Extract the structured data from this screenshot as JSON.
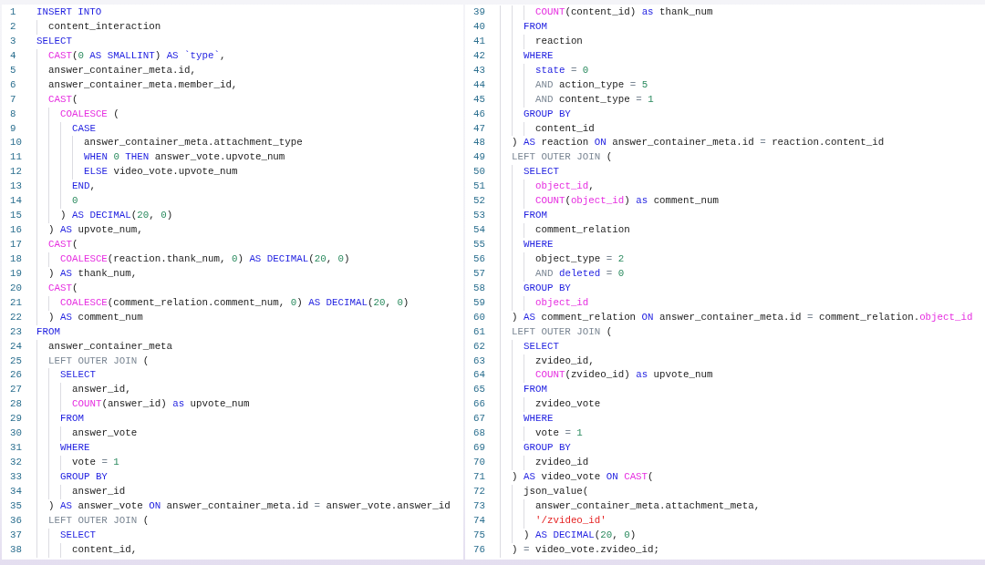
{
  "listing": [
    {
      "number": "1",
      "tokens": [
        {
          "kind": "keyword",
          "text": "INSERT INTO"
        }
      ],
      "children": [
        {
          "number": "2",
          "tokens": [
            {
              "kind": "plain",
              "text": "content_interaction"
            }
          ]
        }
      ]
    },
    {
      "number": "3",
      "tokens": [
        {
          "kind": "keyword",
          "text": "SELECT"
        }
      ],
      "children": [
        {
          "number": "4",
          "tokens": [
            {
              "kind": "function",
              "text": "CAST"
            },
            {
              "kind": "plain",
              "text": "("
            },
            {
              "kind": "number",
              "text": "0"
            },
            {
              "kind": "keyword",
              "text": " AS SMALLINT"
            },
            {
              "kind": "plain",
              "text": ") "
            },
            {
              "kind": "keyword",
              "text": "AS `type`"
            },
            {
              "kind": "plain",
              "text": ","
            }
          ]
        },
        {
          "number": "5",
          "tokens": [
            {
              "kind": "plain",
              "text": "answer_container_meta.id,"
            }
          ]
        },
        {
          "number": "6",
          "tokens": [
            {
              "kind": "plain",
              "text": "answer_container_meta.member_id,"
            }
          ]
        },
        {
          "number": "7",
          "tokens": [
            {
              "kind": "function",
              "text": "CAST"
            },
            {
              "kind": "plain",
              "text": "("
            }
          ],
          "children": [
            {
              "number": "8",
              "tokens": [
                {
                  "kind": "function",
                  "text": "COALESCE"
                },
                {
                  "kind": "plain",
                  "text": " ("
                }
              ],
              "children": [
                {
                  "number": "9",
                  "tokens": [
                    {
                      "kind": "keyword",
                      "text": "CASE"
                    }
                  ],
                  "children": [
                    {
                      "number": "10",
                      "tokens": [
                        {
                          "kind": "plain",
                          "text": "answer_container_meta.attachment_type"
                        }
                      ]
                    },
                    {
                      "number": "11",
                      "tokens": [
                        {
                          "kind": "keyword",
                          "text": "WHEN"
                        },
                        {
                          "kind": "number",
                          "text": " 0"
                        },
                        {
                          "kind": "keyword",
                          "text": " THEN"
                        },
                        {
                          "kind": "plain",
                          "text": " answer_vote.upvote_num"
                        }
                      ]
                    },
                    {
                      "number": "12",
                      "tokens": [
                        {
                          "kind": "keyword",
                          "text": "ELSE"
                        },
                        {
                          "kind": "plain",
                          "text": " video_vote.upvote_num"
                        }
                      ]
                    }
                  ]
                },
                {
                  "number": "13",
                  "tokens": [
                    {
                      "kind": "keyword",
                      "text": "END"
                    },
                    {
                      "kind": "plain",
                      "text": ","
                    }
                  ]
                },
                {
                  "number": "14",
                  "tokens": [
                    {
                      "kind": "number",
                      "text": "0"
                    }
                  ]
                }
              ]
            },
            {
              "number": "15",
              "tokens": [
                {
                  "kind": "plain",
                  "text": ") "
                },
                {
                  "kind": "keyword",
                  "text": "AS DECIMAL"
                },
                {
                  "kind": "plain",
                  "text": "("
                },
                {
                  "kind": "number",
                  "text": "20"
                },
                {
                  "kind": "plain",
                  "text": ", "
                },
                {
                  "kind": "number",
                  "text": "0"
                },
                {
                  "kind": "plain",
                  "text": ")"
                }
              ]
            }
          ]
        },
        {
          "number": "16",
          "tokens": [
            {
              "kind": "plain",
              "text": ") "
            },
            {
              "kind": "keyword",
              "text": "AS"
            },
            {
              "kind": "plain",
              "text": " upvote_num,"
            }
          ]
        },
        {
          "number": "17",
          "tokens": [
            {
              "kind": "function",
              "text": "CAST"
            },
            {
              "kind": "plain",
              "text": "("
            }
          ],
          "children": [
            {
              "number": "18",
              "tokens": [
                {
                  "kind": "function",
                  "text": "COALESCE"
                },
                {
                  "kind": "plain",
                  "text": "(reaction.thank_num, "
                },
                {
                  "kind": "number",
                  "text": "0"
                },
                {
                  "kind": "plain",
                  "text": ") "
                },
                {
                  "kind": "keyword",
                  "text": "AS DECIMAL"
                },
                {
                  "kind": "plain",
                  "text": "("
                },
                {
                  "kind": "number",
                  "text": "20"
                },
                {
                  "kind": "plain",
                  "text": ", "
                },
                {
                  "kind": "number",
                  "text": "0"
                },
                {
                  "kind": "plain",
                  "text": ")"
                }
              ]
            }
          ]
        },
        {
          "number": "19",
          "tokens": [
            {
              "kind": "plain",
              "text": ") "
            },
            {
              "kind": "keyword",
              "text": "AS"
            },
            {
              "kind": "plain",
              "text": " thank_num,"
            }
          ]
        },
        {
          "number": "20",
          "tokens": [
            {
              "kind": "function",
              "text": "CAST"
            },
            {
              "kind": "plain",
              "text": "("
            }
          ],
          "children": [
            {
              "number": "21",
              "tokens": [
                {
                  "kind": "function",
                  "text": "COALESCE"
                },
                {
                  "kind": "plain",
                  "text": "(comment_relation.comment_num, "
                },
                {
                  "kind": "number",
                  "text": "0"
                },
                {
                  "kind": "plain",
                  "text": ") "
                },
                {
                  "kind": "keyword",
                  "text": "AS DECIMAL"
                },
                {
                  "kind": "plain",
                  "text": "("
                },
                {
                  "kind": "number",
                  "text": "20"
                },
                {
                  "kind": "plain",
                  "text": ", "
                },
                {
                  "kind": "number",
                  "text": "0"
                },
                {
                  "kind": "plain",
                  "text": ")"
                }
              ]
            }
          ]
        },
        {
          "number": "22",
          "tokens": [
            {
              "kind": "plain",
              "text": ") "
            },
            {
              "kind": "keyword",
              "text": "AS"
            },
            {
              "kind": "plain",
              "text": " comment_num"
            }
          ]
        }
      ]
    },
    {
      "number": "23",
      "tokens": [
        {
          "kind": "keyword",
          "text": "FROM"
        }
      ],
      "children": [
        {
          "number": "24",
          "tokens": [
            {
              "kind": "plain",
              "text": "answer_container_meta"
            }
          ]
        },
        {
          "number": "25",
          "tokens": [
            {
              "kind": "muted",
              "text": "LEFT OUTER JOIN"
            },
            {
              "kind": "plain",
              "text": " ("
            }
          ],
          "children": [
            {
              "number": "26",
              "tokens": [
                {
                  "kind": "keyword",
                  "text": "SELECT"
                }
              ],
              "children": [
                {
                  "number": "27",
                  "tokens": [
                    {
                      "kind": "plain",
                      "text": "answer_id,"
                    }
                  ]
                },
                {
                  "number": "28",
                  "tokens": [
                    {
                      "kind": "function",
                      "text": "COUNT"
                    },
                    {
                      "kind": "plain",
                      "text": "(answer_id) "
                    },
                    {
                      "kind": "keyword",
                      "text": "as"
                    },
                    {
                      "kind": "plain",
                      "text": " upvote_num"
                    }
                  ]
                }
              ]
            },
            {
              "number": "29",
              "tokens": [
                {
                  "kind": "keyword",
                  "text": "FROM"
                }
              ],
              "children": [
                {
                  "number": "30",
                  "tokens": [
                    {
                      "kind": "plain",
                      "text": "answer_vote"
                    }
                  ]
                }
              ]
            },
            {
              "number": "31",
              "tokens": [
                {
                  "kind": "keyword",
                  "text": "WHERE"
                }
              ],
              "children": [
                {
                  "number": "32",
                  "tokens": [
                    {
                      "kind": "plain",
                      "text": "vote "
                    },
                    {
                      "kind": "muted",
                      "text": "="
                    },
                    {
                      "kind": "number",
                      "text": " 1"
                    }
                  ]
                }
              ]
            },
            {
              "number": "33",
              "tokens": [
                {
                  "kind": "keyword",
                  "text": "GROUP BY"
                }
              ],
              "children": [
                {
                  "number": "34",
                  "tokens": [
                    {
                      "kind": "plain",
                      "text": "answer_id"
                    }
                  ]
                }
              ]
            }
          ]
        },
        {
          "number": "35",
          "tokens": [
            {
              "kind": "plain",
              "text": ") "
            },
            {
              "kind": "keyword",
              "text": "AS"
            },
            {
              "kind": "plain",
              "text": " answer_vote "
            },
            {
              "kind": "keyword",
              "text": "ON"
            },
            {
              "kind": "plain",
              "text": " answer_container_meta.id "
            },
            {
              "kind": "muted",
              "text": "="
            },
            {
              "kind": "plain",
              "text": " answer_vote.answer_id"
            }
          ]
        },
        {
          "number": "36",
          "tokens": [
            {
              "kind": "muted",
              "text": "LEFT OUTER JOIN"
            },
            {
              "kind": "plain",
              "text": " ("
            }
          ],
          "children": [
            {
              "number": "37",
              "tokens": [
                {
                  "kind": "keyword",
                  "text": "SELECT"
                }
              ],
              "children": [
                {
                  "number": "38",
                  "tokens": [
                    {
                      "kind": "plain",
                      "text": "content_id,"
                    }
                  ]
                },
                {
                  "number": "39",
                  "tokens": [
                    {
                      "kind": "function",
                      "text": "COUNT"
                    },
                    {
                      "kind": "plain",
                      "text": "(content_id) "
                    },
                    {
                      "kind": "keyword",
                      "text": "as"
                    },
                    {
                      "kind": "plain",
                      "text": " thank_num"
                    }
                  ]
                }
              ]
            },
            {
              "number": "40",
              "tokens": [
                {
                  "kind": "keyword",
                  "text": "FROM"
                }
              ],
              "children": [
                {
                  "number": "41",
                  "tokens": [
                    {
                      "kind": "plain",
                      "text": "reaction"
                    }
                  ]
                }
              ]
            },
            {
              "number": "42",
              "tokens": [
                {
                  "kind": "keyword",
                  "text": "WHERE"
                }
              ],
              "children": [
                {
                  "number": "43",
                  "tokens": [
                    {
                      "kind": "keyword",
                      "text": "state"
                    },
                    {
                      "kind": "muted",
                      "text": " ="
                    },
                    {
                      "kind": "number",
                      "text": " 0"
                    }
                  ]
                },
                {
                  "number": "44",
                  "tokens": [
                    {
                      "kind": "muted",
                      "text": "AND"
                    },
                    {
                      "kind": "plain",
                      "text": " action_type "
                    },
                    {
                      "kind": "muted",
                      "text": "="
                    },
                    {
                      "kind": "number",
                      "text": " 5"
                    }
                  ]
                },
                {
                  "number": "45",
                  "tokens": [
                    {
                      "kind": "muted",
                      "text": "AND"
                    },
                    {
                      "kind": "plain",
                      "text": " content_type "
                    },
                    {
                      "kind": "muted",
                      "text": "="
                    },
                    {
                      "kind": "number",
                      "text": " 1"
                    }
                  ]
                }
              ]
            },
            {
              "number": "46",
              "tokens": [
                {
                  "kind": "keyword",
                  "text": "GROUP BY"
                }
              ],
              "children": [
                {
                  "number": "47",
                  "tokens": [
                    {
                      "kind": "plain",
                      "text": "content_id"
                    }
                  ]
                }
              ]
            }
          ]
        },
        {
          "number": "48",
          "tokens": [
            {
              "kind": "plain",
              "text": ") "
            },
            {
              "kind": "keyword",
              "text": "AS"
            },
            {
              "kind": "plain",
              "text": " reaction "
            },
            {
              "kind": "keyword",
              "text": "ON"
            },
            {
              "kind": "plain",
              "text": " answer_container_meta.id "
            },
            {
              "kind": "muted",
              "text": "="
            },
            {
              "kind": "plain",
              "text": " reaction.content_id"
            }
          ]
        },
        {
          "number": "49",
          "tokens": [
            {
              "kind": "muted",
              "text": "LEFT OUTER JOIN"
            },
            {
              "kind": "plain",
              "text": " ("
            }
          ],
          "children": [
            {
              "number": "50",
              "tokens": [
                {
                  "kind": "keyword",
                  "text": "SELECT"
                }
              ],
              "children": [
                {
                  "number": "51",
                  "tokens": [
                    {
                      "kind": "function",
                      "text": "object_id"
                    },
                    {
                      "kind": "plain",
                      "text": ","
                    }
                  ]
                },
                {
                  "number": "52",
                  "tokens": [
                    {
                      "kind": "function",
                      "text": "COUNT"
                    },
                    {
                      "kind": "plain",
                      "text": "("
                    },
                    {
                      "kind": "function",
                      "text": "object_id"
                    },
                    {
                      "kind": "plain",
                      "text": ") "
                    },
                    {
                      "kind": "keyword",
                      "text": "as"
                    },
                    {
                      "kind": "plain",
                      "text": " comment_num"
                    }
                  ]
                }
              ]
            },
            {
              "number": "53",
              "tokens": [
                {
                  "kind": "keyword",
                  "text": "FROM"
                }
              ],
              "children": [
                {
                  "number": "54",
                  "tokens": [
                    {
                      "kind": "plain",
                      "text": "comment_relation"
                    }
                  ]
                }
              ]
            },
            {
              "number": "55",
              "tokens": [
                {
                  "kind": "keyword",
                  "text": "WHERE"
                }
              ],
              "children": [
                {
                  "number": "56",
                  "tokens": [
                    {
                      "kind": "plain",
                      "text": "object_type "
                    },
                    {
                      "kind": "muted",
                      "text": "="
                    },
                    {
                      "kind": "number",
                      "text": " 2"
                    }
                  ]
                },
                {
                  "number": "57",
                  "tokens": [
                    {
                      "kind": "muted",
                      "text": "AND"
                    },
                    {
                      "kind": "keyword",
                      "text": " deleted"
                    },
                    {
                      "kind": "muted",
                      "text": " ="
                    },
                    {
                      "kind": "number",
                      "text": " 0"
                    }
                  ]
                }
              ]
            },
            {
              "number": "58",
              "tokens": [
                {
                  "kind": "keyword",
                  "text": "GROUP BY"
                }
              ],
              "children": [
                {
                  "number": "59",
                  "tokens": [
                    {
                      "kind": "function",
                      "text": "object_id"
                    }
                  ]
                }
              ]
            }
          ]
        },
        {
          "number": "60",
          "tokens": [
            {
              "kind": "plain",
              "text": ") "
            },
            {
              "kind": "keyword",
              "text": "AS"
            },
            {
              "kind": "plain",
              "text": " comment_relation "
            },
            {
              "kind": "keyword",
              "text": "ON"
            },
            {
              "kind": "plain",
              "text": " answer_container_meta.id "
            },
            {
              "kind": "muted",
              "text": "="
            },
            {
              "kind": "plain",
              "text": " comment_relation."
            },
            {
              "kind": "function",
              "text": "object_id"
            }
          ]
        },
        {
          "number": "61",
          "tokens": [
            {
              "kind": "muted",
              "text": "LEFT OUTER JOIN"
            },
            {
              "kind": "plain",
              "text": " ("
            }
          ],
          "children": [
            {
              "number": "62",
              "tokens": [
                {
                  "kind": "keyword",
                  "text": "SELECT"
                }
              ],
              "children": [
                {
                  "number": "63",
                  "tokens": [
                    {
                      "kind": "plain",
                      "text": "zvideo_id,"
                    }
                  ]
                },
                {
                  "number": "64",
                  "tokens": [
                    {
                      "kind": "function",
                      "text": "COUNT"
                    },
                    {
                      "kind": "plain",
                      "text": "(zvideo_id) "
                    },
                    {
                      "kind": "keyword",
                      "text": "as"
                    },
                    {
                      "kind": "plain",
                      "text": " upvote_num"
                    }
                  ]
                }
              ]
            },
            {
              "number": "65",
              "tokens": [
                {
                  "kind": "keyword",
                  "text": "FROM"
                }
              ],
              "children": [
                {
                  "number": "66",
                  "tokens": [
                    {
                      "kind": "plain",
                      "text": "zvideo_vote"
                    }
                  ]
                }
              ]
            },
            {
              "number": "67",
              "tokens": [
                {
                  "kind": "keyword",
                  "text": "WHERE"
                }
              ],
              "children": [
                {
                  "number": "68",
                  "tokens": [
                    {
                      "kind": "plain",
                      "text": "vote "
                    },
                    {
                      "kind": "muted",
                      "text": "="
                    },
                    {
                      "kind": "number",
                      "text": " 1"
                    }
                  ]
                }
              ]
            },
            {
              "number": "69",
              "tokens": [
                {
                  "kind": "keyword",
                  "text": "GROUP BY"
                }
              ],
              "children": [
                {
                  "number": "70",
                  "tokens": [
                    {
                      "kind": "plain",
                      "text": "zvideo_id"
                    }
                  ]
                }
              ]
            }
          ]
        },
        {
          "number": "71",
          "tokens": [
            {
              "kind": "plain",
              "text": ") "
            },
            {
              "kind": "keyword",
              "text": "AS"
            },
            {
              "kind": "plain",
              "text": " video_vote "
            },
            {
              "kind": "keyword",
              "text": "ON"
            },
            {
              "kind": "function",
              "text": " CAST"
            },
            {
              "kind": "plain",
              "text": "("
            }
          ],
          "children": [
            {
              "number": "72",
              "tokens": [
                {
                  "kind": "plain",
                  "text": "json_value("
                }
              ],
              "children": [
                {
                  "number": "73",
                  "tokens": [
                    {
                      "kind": "plain",
                      "text": "answer_container_meta.attachment_meta,"
                    }
                  ]
                },
                {
                  "number": "74",
                  "tokens": [
                    {
                      "kind": "string",
                      "text": "'/zvideo_id'"
                    }
                  ]
                }
              ]
            },
            {
              "number": "75",
              "tokens": [
                {
                  "kind": "plain",
                  "text": ") "
                },
                {
                  "kind": "keyword",
                  "text": "AS DECIMAL"
                },
                {
                  "kind": "plain",
                  "text": "("
                },
                {
                  "kind": "number",
                  "text": "20"
                },
                {
                  "kind": "plain",
                  "text": ", "
                },
                {
                  "kind": "number",
                  "text": "0"
                },
                {
                  "kind": "plain",
                  "text": ")"
                }
              ]
            }
          ]
        },
        {
          "number": "76",
          "tokens": [
            {
              "kind": "plain",
              "text": ") "
            },
            {
              "kind": "muted",
              "text": "="
            },
            {
              "kind": "plain",
              "text": " video_vote.zvideo_id;"
            }
          ]
        }
      ]
    }
  ]
}
